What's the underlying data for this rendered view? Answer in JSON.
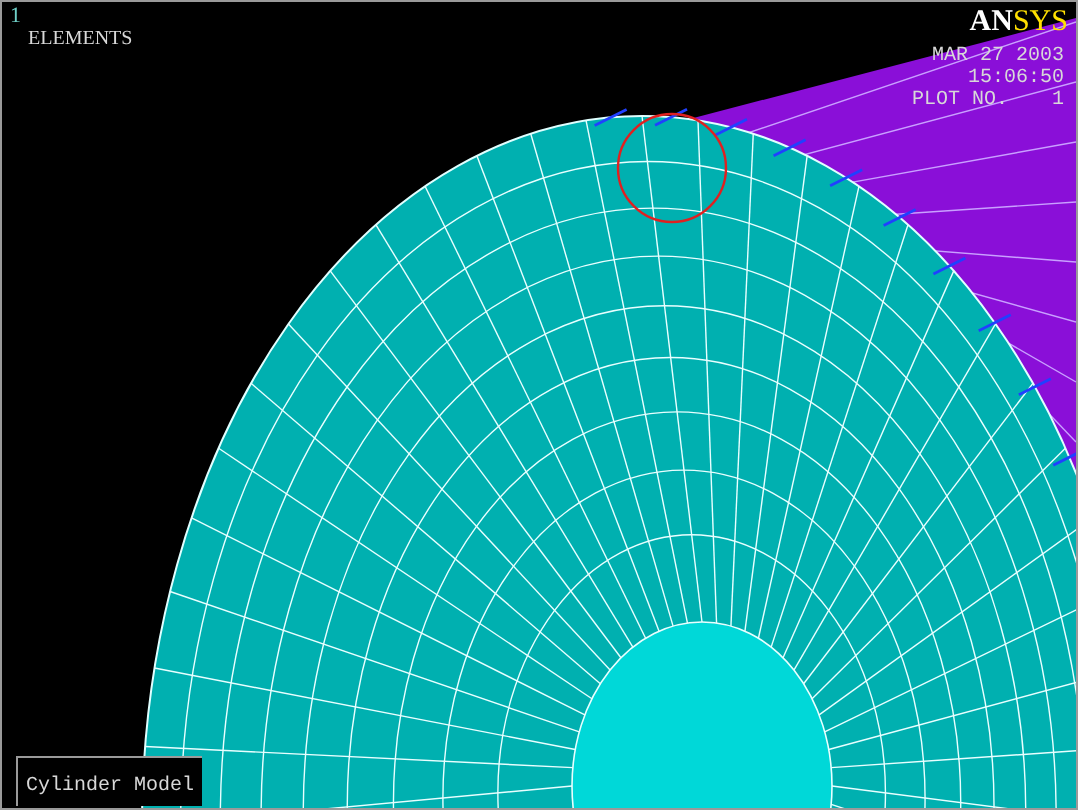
{
  "graphics_window": {
    "window_number": "1",
    "plot_label": "ELEMENTS",
    "logo": {
      "part_1": "AN",
      "part_2": "SYS"
    },
    "date": "MAR 27 2003",
    "time": "15:06:50",
    "plot_number_label": "PLOT NO.",
    "plot_number": "1",
    "title": "Cylinder Model"
  }
}
